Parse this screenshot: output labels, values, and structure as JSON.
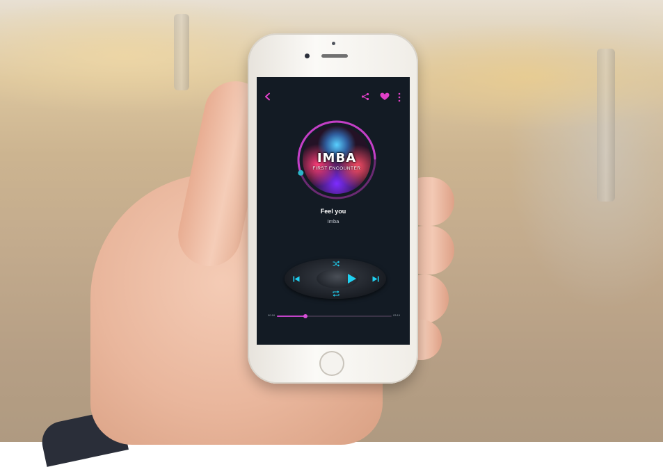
{
  "app": {
    "accent_color": "#e040c8",
    "control_color": "#1fd1f2",
    "background_color": "#131b24"
  },
  "toolbar": {
    "back_icon": "chevron-left-icon",
    "share_icon": "share-icon",
    "favorite_icon": "heart-icon",
    "more_icon": "more-vertical-icon"
  },
  "album_art": {
    "title": "IMBA",
    "subtitle": "FIRST ENCOUNTER"
  },
  "track": {
    "title": "Feel you",
    "artist": "Imba",
    "ring_progress": 0.25
  },
  "controls": {
    "shuffle_icon": "shuffle-icon",
    "repeat_icon": "repeat-icon",
    "prev_icon": "skip-previous-icon",
    "play_icon": "play-icon",
    "next_icon": "skip-next-icon"
  },
  "seek": {
    "current_time": "00:18",
    "total_time": "03:19",
    "progress": 0.25
  }
}
